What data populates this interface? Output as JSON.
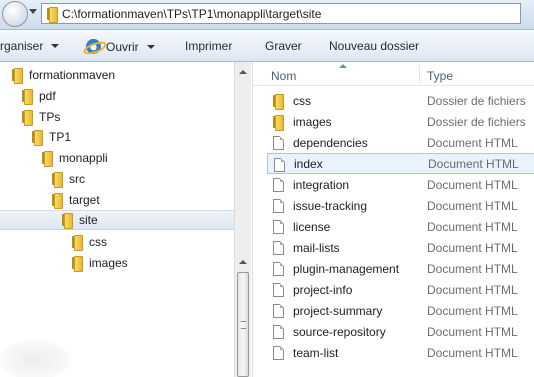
{
  "address_bar": {
    "path": "C:\\formationmaven\\TPs\\TP1\\monappli\\target\\site"
  },
  "toolbar": {
    "organize_label": "rganiser",
    "open_label": "Ouvrir",
    "print_label": "Imprimer",
    "burn_label": "Graver",
    "new_folder_label": "Nouveau dossier"
  },
  "tree": {
    "items": [
      {
        "label": "formationmaven"
      },
      {
        "label": "pdf"
      },
      {
        "label": "TPs"
      },
      {
        "label": "TP1"
      },
      {
        "label": "monappli"
      },
      {
        "label": "src"
      },
      {
        "label": "target"
      },
      {
        "label": "site"
      },
      {
        "label": "css"
      },
      {
        "label": "images"
      }
    ]
  },
  "file_list": {
    "columns": {
      "name": "Nom",
      "type": "Type"
    },
    "rows": [
      {
        "name": "css",
        "type": "Dossier de fichiers",
        "icon": "folder-icon"
      },
      {
        "name": "images",
        "type": "Dossier de fichiers",
        "icon": "folder-icon"
      },
      {
        "name": "dependencies",
        "type": "Document HTML",
        "icon": "html-doc-icon"
      },
      {
        "name": "index",
        "type": "Document HTML",
        "icon": "html-doc-icon"
      },
      {
        "name": "integration",
        "type": "Document HTML",
        "icon": "html-doc-icon"
      },
      {
        "name": "issue-tracking",
        "type": "Document HTML",
        "icon": "html-doc-icon"
      },
      {
        "name": "license",
        "type": "Document HTML",
        "icon": "html-doc-icon"
      },
      {
        "name": "mail-lists",
        "type": "Document HTML",
        "icon": "html-doc-icon"
      },
      {
        "name": "plugin-management",
        "type": "Document HTML",
        "icon": "html-doc-icon"
      },
      {
        "name": "project-info",
        "type": "Document HTML",
        "icon": "html-doc-icon"
      },
      {
        "name": "project-summary",
        "type": "Document HTML",
        "icon": "html-doc-icon"
      },
      {
        "name": "source-repository",
        "type": "Document HTML",
        "icon": "html-doc-icon"
      },
      {
        "name": "team-list",
        "type": "Document HTML",
        "icon": "html-doc-icon"
      }
    ]
  },
  "colors": {
    "selection": "#eaf2fb",
    "selection_border": "#a9c7e8",
    "folder": "#f2cc4c"
  }
}
